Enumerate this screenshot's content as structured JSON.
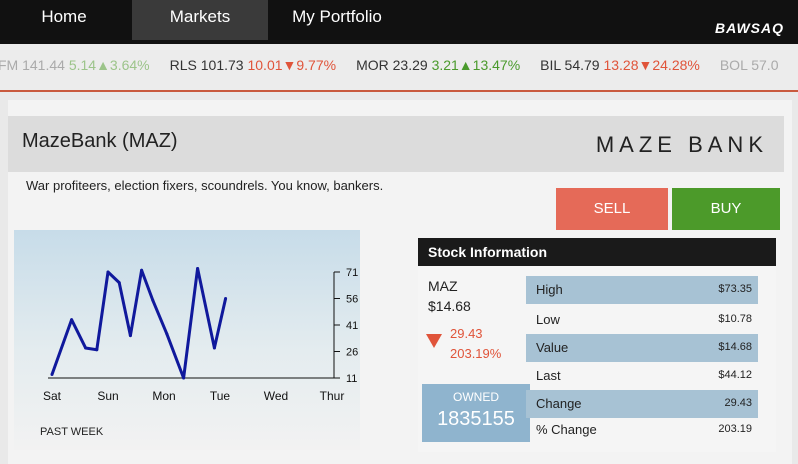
{
  "nav": {
    "home": "Home",
    "markets": "Markets",
    "portfolio": "My Portfolio",
    "brand": "BAWSAQ"
  },
  "ticker": [
    {
      "sym": "FM",
      "price": "141.44",
      "change": "5.14",
      "dir": "up",
      "pct": "3.64%",
      "fade": true
    },
    {
      "sym": "RLS",
      "price": "101.73",
      "change": "10.01",
      "dir": "down",
      "pct": "9.77%",
      "fade": false
    },
    {
      "sym": "MOR",
      "price": "23.29",
      "change": "3.21",
      "dir": "up",
      "pct": "13.47%",
      "fade": false
    },
    {
      "sym": "BIL",
      "price": "54.79",
      "change": "13.28",
      "dir": "down",
      "pct": "24.28%",
      "fade": false
    },
    {
      "sym": "BOL",
      "price": "57.0",
      "change": "",
      "dir": "",
      "pct": "",
      "fade": true
    }
  ],
  "stock": {
    "title": "MazeBank (MAZ)",
    "logo": "MAZE BANK",
    "description": "War profiteers, election fixers, scoundrels. You know, bankers."
  },
  "actions": {
    "sell": "SELL",
    "buy": "BUY"
  },
  "chart_data": {
    "type": "line",
    "categories": [
      "Sat",
      "Sun",
      "Mon",
      "Tue",
      "Wed",
      "Thur"
    ],
    "x": [
      0,
      0.35,
      0.6,
      0.8,
      1,
      1.2,
      1.4,
      1.6,
      1.8,
      2.05,
      2.35,
      2.6,
      2.9,
      3.1,
      3.5,
      3.7,
      3.9
    ],
    "values": [
      13,
      44,
      28,
      27,
      71,
      65,
      35,
      72,
      55,
      36,
      11,
      73,
      28,
      56
    ],
    "ylim": [
      11,
      71
    ],
    "yticks": [
      11,
      26,
      41,
      56,
      71
    ],
    "xlabel": "PAST WEEK",
    "color": "#10199c"
  },
  "info": {
    "header": "Stock Information",
    "symbol": "MAZ",
    "price": "$14.68",
    "change": "29.43",
    "change_pct": "203.19%",
    "owned_label": "OWNED",
    "owned_value": "1835155",
    "rows": [
      {
        "label": "High",
        "value": "$73.35"
      },
      {
        "label": "Low",
        "value": "$10.78"
      },
      {
        "label": "Value",
        "value": "$14.68"
      },
      {
        "label": "Last",
        "value": "$44.12"
      },
      {
        "label": "Change",
        "value": "29.43"
      },
      {
        "label": "% Change",
        "value": "203.19"
      }
    ]
  },
  "colors": {
    "sell": "#e56a58",
    "buy": "#4c9a2a",
    "down": "#e0543a",
    "up": "#4a9a2c",
    "row_shade": "#a7c2d4"
  }
}
